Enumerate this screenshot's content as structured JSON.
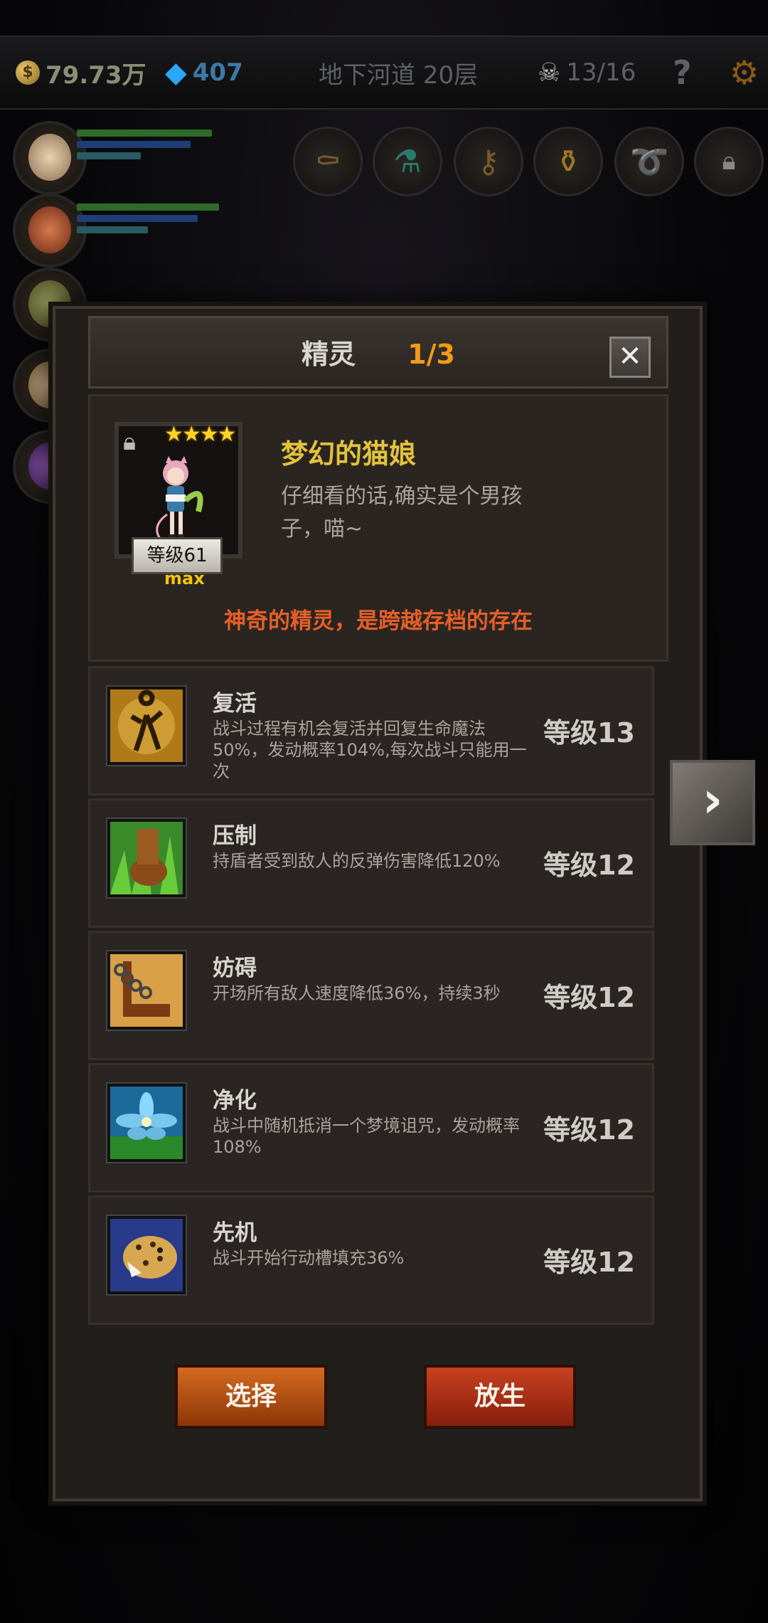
{
  "topbar": {
    "gold": "79.73万",
    "gems": "407",
    "floor": "地下河道 20层",
    "kills": "13/16",
    "help_icon": "?",
    "settings_icon": "gear-icon"
  },
  "modal": {
    "title": "精灵",
    "page": "1/3",
    "close_icon": "✕",
    "spirit": {
      "name": "梦幻的猫娘",
      "description": "仔细看的话,确实是个男孩子，喵~",
      "stars": "★★★★",
      "level": "等级61",
      "max": "max",
      "tagline": "神奇的精灵，是跨越存档的存在"
    },
    "skills": [
      {
        "name": "复活",
        "description": "战斗过程有机会复活并回复生命魔法50%，发动概率104%,每次战斗只能用一次",
        "level": "等级13"
      },
      {
        "name": "压制",
        "description": "持盾者受到敌人的反弹伤害降低120%",
        "level": "等级12"
      },
      {
        "name": "妨碍",
        "description": "开场所有敌人速度降低36%，持续3秒",
        "level": "等级12"
      },
      {
        "name": "净化",
        "description": "战斗中随机抵消一个梦境诅咒，发动概率108%",
        "level": "等级12"
      },
      {
        "name": "先机",
        "description": "战斗开始行动槽填充36%",
        "level": "等级12"
      }
    ],
    "buttons": {
      "select": "选择",
      "release": "放生"
    },
    "next_icon": "›"
  },
  "colors": {
    "accent_gold": "#e3c23c",
    "accent_orange": "#f39a15",
    "tagline_red": "#e55f28"
  }
}
